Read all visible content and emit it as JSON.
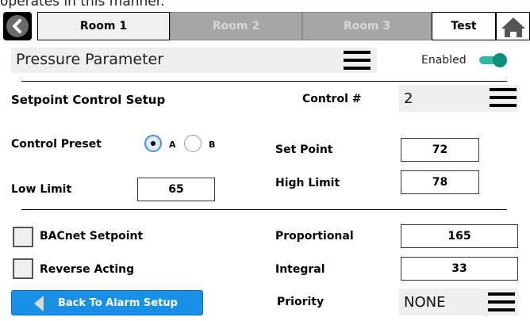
{
  "caption": "operates in this manner.",
  "tabs": {
    "room1": "Room 1",
    "room2": "Room 2",
    "room3": "Room 3",
    "test": "Test"
  },
  "header": {
    "title": "Pressure Parameter",
    "enabled_label": "Enabled",
    "enabled": true
  },
  "setpoint_control": {
    "title": "Setpoint Control Setup",
    "control_label": "Control #",
    "control_value": "2"
  },
  "preset": {
    "label": "Control Preset",
    "option_a": "A",
    "option_b": "B",
    "selected": "A"
  },
  "fields": {
    "set_point_label": "Set Point",
    "set_point_value": "72",
    "low_limit_label": "Low Limit",
    "low_limit_value": "65",
    "high_limit_label": "High Limit",
    "high_limit_value": "78",
    "bacnet_label": "BACnet Setpoint",
    "reverse_label": "Reverse Acting",
    "proportional_label": "Proportional",
    "proportional_value": "165",
    "integral_label": "Integral",
    "integral_value": "33",
    "priority_label": "Priority",
    "priority_value": "NONE"
  },
  "buttons": {
    "back_to_alarm": "Back To Alarm Setup"
  },
  "colors": {
    "accent": "#1a8fe6",
    "toggle": "#2fb8a4",
    "tab_inactive": "#a6a6a6"
  }
}
